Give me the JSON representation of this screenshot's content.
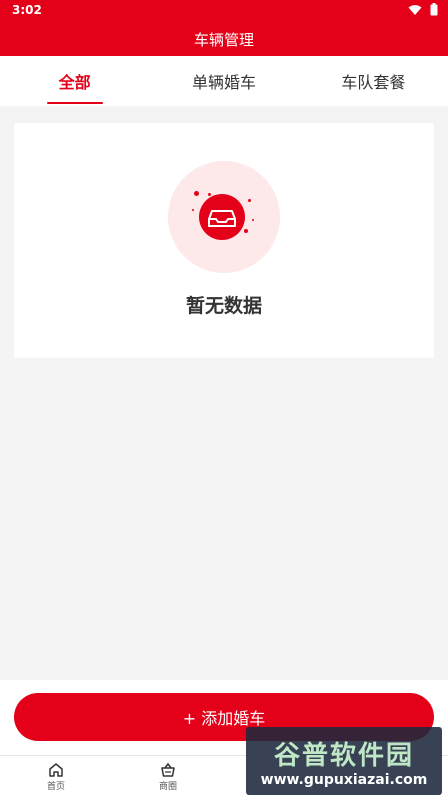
{
  "status_bar": {
    "time": "3:02"
  },
  "header": {
    "title": "车辆管理"
  },
  "tabs": [
    {
      "label": "全部",
      "active": true
    },
    {
      "label": "单辆婚车",
      "active": false
    },
    {
      "label": "车队套餐",
      "active": false
    }
  ],
  "empty_state": {
    "message": "暂无数据",
    "icon": "inbox-icon"
  },
  "add_button": {
    "label": "+ 添加婚车"
  },
  "bottom_nav": [
    {
      "label": "首页",
      "icon": "home-icon"
    },
    {
      "label": "商圈",
      "icon": "basket-icon"
    }
  ],
  "watermark": {
    "brand": "谷普软件园",
    "url": "www.gupuxiazai.com"
  },
  "colors": {
    "accent": "#e5001a",
    "background": "#f4f4f4",
    "empty_circle": "#fde8ea"
  }
}
